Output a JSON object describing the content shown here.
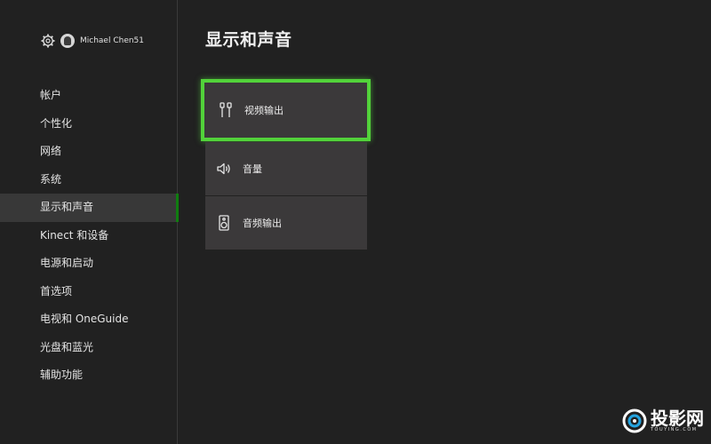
{
  "user": {
    "name": "Michael Chen51"
  },
  "sidebar": {
    "items": [
      {
        "label": "帐户"
      },
      {
        "label": "个性化"
      },
      {
        "label": "网络"
      },
      {
        "label": "系统"
      },
      {
        "label": "显示和声音",
        "active": true
      },
      {
        "label": "Kinect 和设备"
      },
      {
        "label": "电源和启动"
      },
      {
        "label": "首选项"
      },
      {
        "label": "电视和 OneGuide"
      },
      {
        "label": "光盘和蓝光"
      },
      {
        "label": "辅助功能"
      }
    ]
  },
  "main": {
    "title": "显示和声音",
    "tiles": [
      {
        "label": "视频输出",
        "icon": "video-output-icon",
        "focused": true
      },
      {
        "label": "音量",
        "icon": "speaker-icon"
      },
      {
        "label": "音频输出",
        "icon": "audio-output-icon"
      }
    ]
  },
  "watermark": {
    "text": "投影网",
    "sub": "TOUYING.COM"
  },
  "colors": {
    "background": "#212121",
    "tile": "#3b393a",
    "focus_border": "#52d23a",
    "active_indicator": "#107c10",
    "active_item_bg": "#383838"
  }
}
